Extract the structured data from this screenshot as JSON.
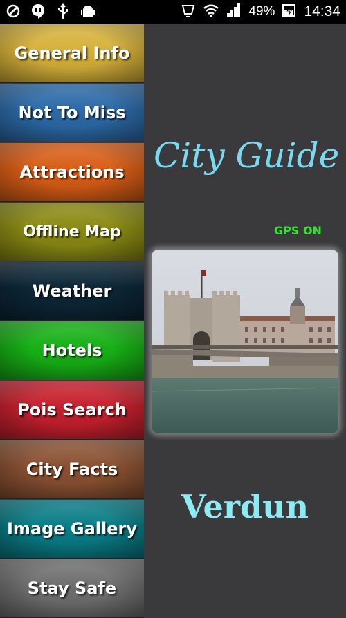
{
  "status_bar": {
    "icons": [
      "signal-swap-icon",
      "hangouts-icon",
      "usb-icon",
      "android-icon",
      "vibrate-icon",
      "wifi-icon",
      "cell-signal-icon",
      "battery-charging-icon"
    ],
    "battery": "49%",
    "time": "14:34"
  },
  "menu": {
    "items": [
      {
        "label": "General Info",
        "color": "#d6b13a"
      },
      {
        "label": "Not To Miss",
        "color": "#2c6aa8"
      },
      {
        "label": "Attractions",
        "color": "#d85d16"
      },
      {
        "label": "Offline Map",
        "color": "#8a8a14"
      },
      {
        "label": "Weather",
        "color": "#0c2636"
      },
      {
        "label": "Hotels",
        "color": "#17b016"
      },
      {
        "label": "Pois Search",
        "color": "#c6202d"
      },
      {
        "label": "City Facts",
        "color": "#8a5132"
      },
      {
        "label": "Image Gallery",
        "color": "#0a7d87"
      },
      {
        "label": "Stay Safe",
        "color": "#6f6f6f"
      }
    ]
  },
  "main": {
    "title": "City Guide",
    "gps_status": "GPS ON",
    "city_name": "Verdun"
  }
}
